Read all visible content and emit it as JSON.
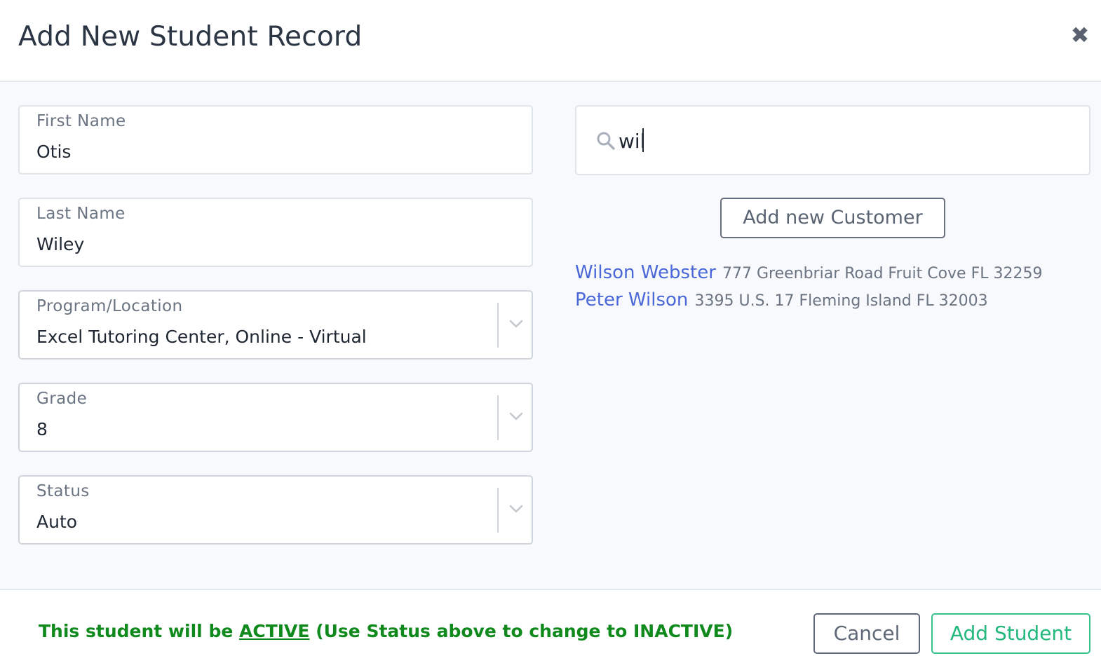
{
  "dialog": {
    "title": "Add New Student Record",
    "close_glyph": "✖"
  },
  "form": {
    "first_name": {
      "label": "First Name",
      "value": "Otis"
    },
    "last_name": {
      "label": "Last Name",
      "value": "Wiley"
    },
    "program_location": {
      "label": "Program/Location",
      "value": "Excel Tutoring Center, Online - Virtual"
    },
    "grade": {
      "label": "Grade",
      "value": "8"
    },
    "status": {
      "label": "Status",
      "value": "Auto"
    }
  },
  "customer_search": {
    "value": "wil",
    "icon": "search-icon",
    "add_button_label": "Add new Customer",
    "results": [
      {
        "name": "Wilson Webster",
        "address": "777 Greenbriar Road Fruit Cove FL 32259"
      },
      {
        "name": "Peter Wilson",
        "address": "3395 U.S. 17 Fleming Island FL 32003"
      }
    ]
  },
  "footer": {
    "note_prefix": "This student will be ",
    "note_active": "ACTIVE",
    "note_suffix": " (Use Status above to change to INACTIVE)",
    "note_color": "#118a1d",
    "cancel_label": "Cancel",
    "submit_label": "Add Student",
    "submit_color": "#23b87c"
  }
}
